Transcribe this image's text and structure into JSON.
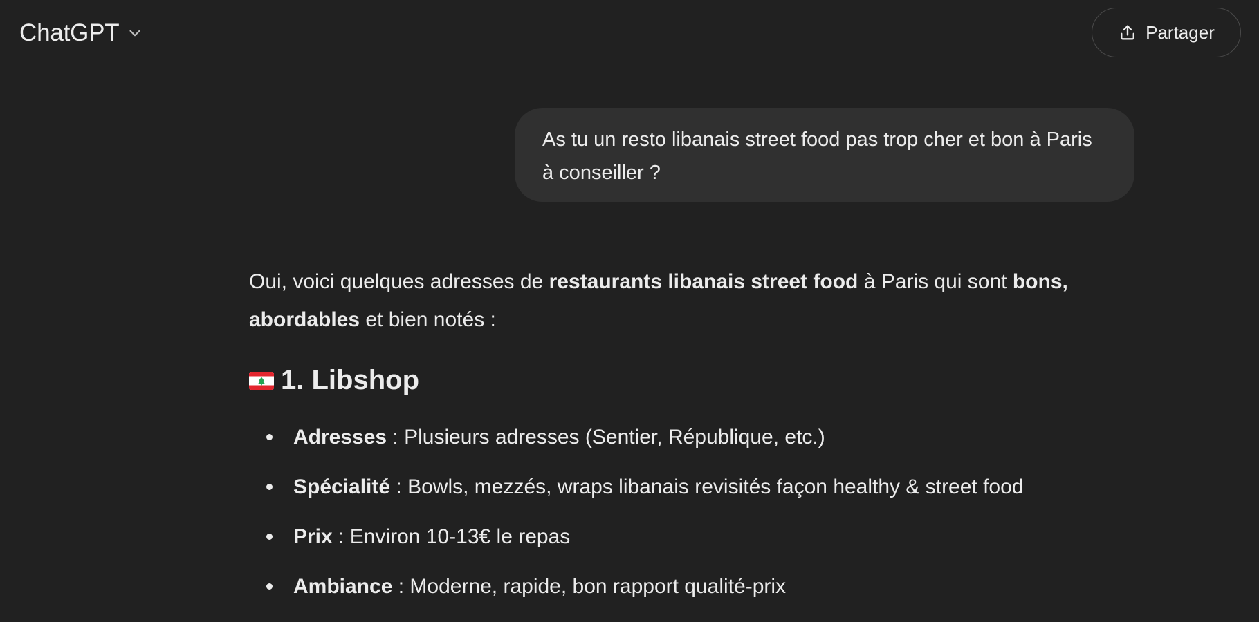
{
  "header": {
    "model_name": "ChatGPT",
    "share_label": "Partager"
  },
  "conversation": {
    "user_message": "As tu un resto libanais street food pas trop cher et bon à Paris à conseiller ?",
    "assistant": {
      "intro": {
        "part1": "Oui, voici quelques adresses de ",
        "bold1": "restaurants libanais street food",
        "part2": " à Paris qui sont ",
        "bold2": "bons, abordables",
        "part3": " et bien notés :"
      },
      "section_heading": "1. Libshop",
      "flag_icon": "lebanon-flag-icon",
      "items": [
        {
          "key": "Adresses",
          "value": " : Plusieurs adresses (Sentier, République, etc.)"
        },
        {
          "key": "Spécialité",
          "value": " : Bowls, mezzés, wraps libanais revisités façon healthy & street food"
        },
        {
          "key": "Prix",
          "value": " : Environ 10-13€ le repas"
        },
        {
          "key": "Ambiance",
          "value": " : Moderne, rapide, bon rapport qualité-prix"
        }
      ]
    }
  },
  "colors": {
    "background": "#212121",
    "user_bubble": "#303030",
    "text": "#ececec",
    "flag_red": "#e3262f",
    "flag_green": "#23a454"
  }
}
